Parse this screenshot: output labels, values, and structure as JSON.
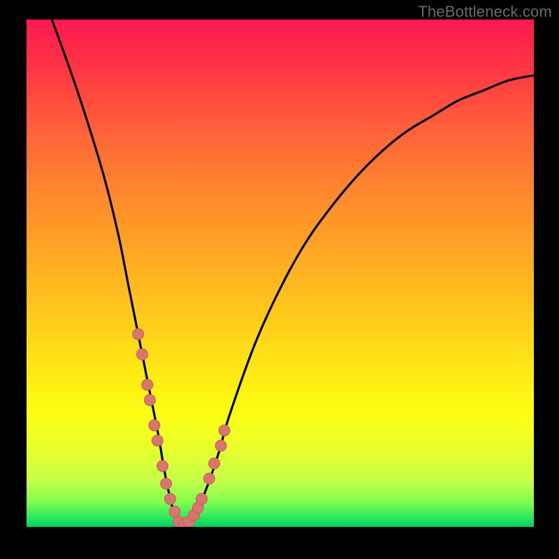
{
  "watermark": "TheBottleneck.com",
  "chart_data": {
    "type": "line",
    "title": "",
    "xlabel": "",
    "ylabel": "",
    "xlim": [
      0,
      100
    ],
    "ylim": [
      0,
      100
    ],
    "series": [
      {
        "name": "bottleneck-curve",
        "x": [
          5,
          10,
          15,
          18,
          20,
          22,
          24,
          26,
          27,
          28,
          29,
          30,
          31,
          32,
          33,
          34,
          36,
          38,
          40,
          45,
          50,
          55,
          60,
          65,
          70,
          75,
          80,
          85,
          90,
          95,
          100
        ],
        "values": [
          100,
          86,
          70,
          58,
          48,
          38,
          28,
          18,
          12,
          7,
          3,
          0.5,
          0,
          0.5,
          2,
          4,
          9,
          15,
          22,
          36,
          47,
          56,
          63,
          69,
          74,
          78,
          81,
          84,
          86,
          88,
          89
        ]
      }
    ],
    "markers": {
      "name": "emphasis-points",
      "x": [
        22,
        22.8,
        23.8,
        24.3,
        25.2,
        25.8,
        26.8,
        27.5,
        28.3,
        29.2,
        30,
        31,
        32,
        33,
        33.8,
        34.5,
        36,
        37,
        38.3,
        39
      ],
      "values": [
        38,
        34,
        28,
        25,
        20,
        17,
        12,
        8.5,
        5.5,
        3,
        1,
        0.4,
        1,
        2.3,
        3.8,
        5.5,
        9.5,
        12.5,
        16,
        19
      ]
    },
    "gradient_note": "vertical background gradient red→yellow→green indicating bottleneck severity"
  }
}
